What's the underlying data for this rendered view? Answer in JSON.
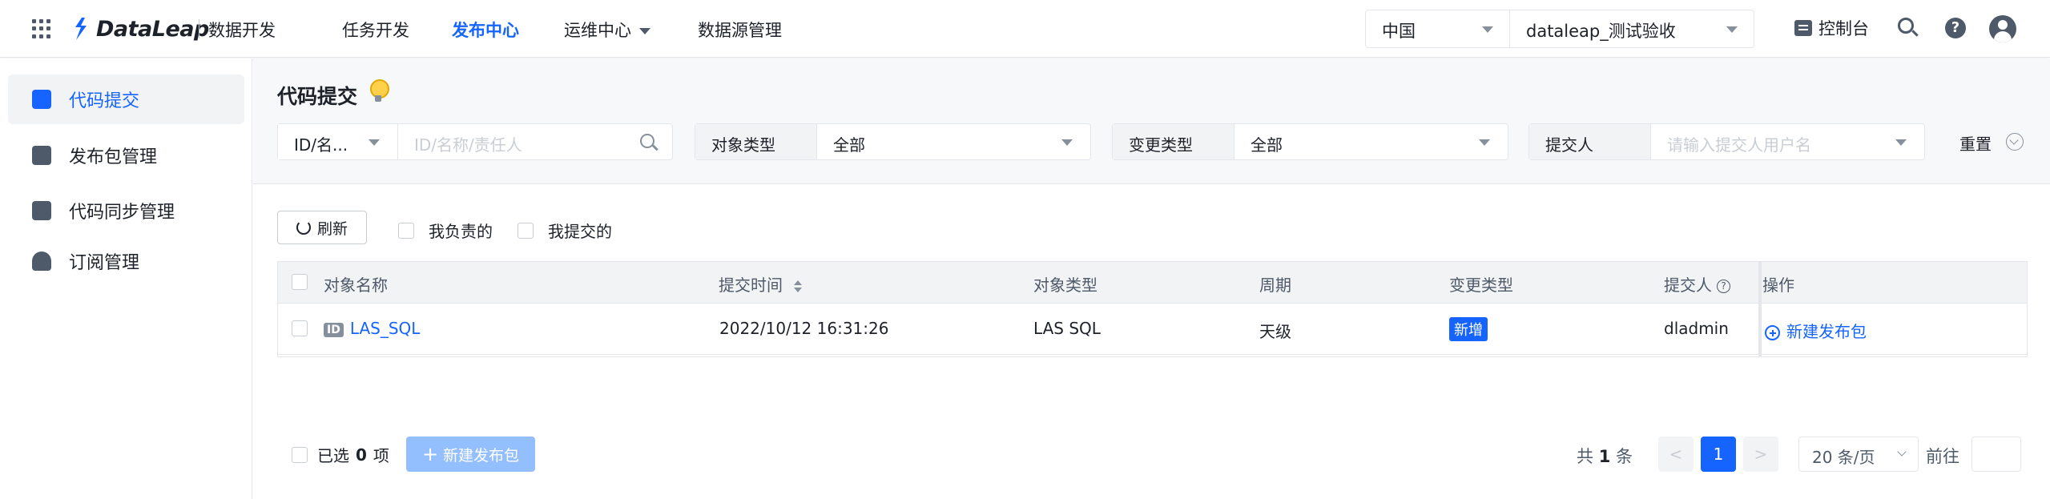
{
  "topbar": {
    "brand": "DataLeap",
    "product": "数据开发",
    "nav": [
      {
        "label": "任务开发",
        "active": false,
        "has_dropdown": false
      },
      {
        "label": "发布中心",
        "active": true,
        "has_dropdown": false
      },
      {
        "label": "运维中心",
        "active": false,
        "has_dropdown": true
      },
      {
        "label": "数据源管理",
        "active": false,
        "has_dropdown": false
      }
    ],
    "region": "中国",
    "project": "dataleap_测试验收",
    "console_label": "控制台",
    "icons": [
      "apps-grid-icon",
      "console-icon",
      "search-icon",
      "help-icon",
      "user-avatar-icon"
    ]
  },
  "sidebar": {
    "items": [
      {
        "label": "代码提交",
        "icon": "terminal-icon",
        "active": true
      },
      {
        "label": "发布包管理",
        "icon": "package-icon",
        "active": false
      },
      {
        "label": "代码同步管理",
        "icon": "code-sync-icon",
        "active": false
      },
      {
        "label": "订阅管理",
        "icon": "bell-icon",
        "active": false
      }
    ]
  },
  "page": {
    "title": "代码提交",
    "title_icon": "lightbulb-icon"
  },
  "filters": {
    "id_type": "ID/名...",
    "search_placeholder": "ID/名称/责任人",
    "object_type_label": "对象类型",
    "object_type_value": "全部",
    "change_type_label": "变更类型",
    "change_type_value": "全部",
    "submitter_label": "提交人",
    "submitter_placeholder": "请输入提交人用户名",
    "reset_label": "重置"
  },
  "toolbar": {
    "refresh_label": "刷新",
    "mine_label": "我负责的",
    "submitted_label": "我提交的"
  },
  "table": {
    "columns": [
      "对象名称",
      "提交时间",
      "对象类型",
      "周期",
      "变更类型",
      "提交人",
      "操作"
    ],
    "rows": [
      {
        "id_badge": "ID",
        "name": "LAS_SQL",
        "time": "2022/10/12  16:31:26",
        "type": "LAS SQL",
        "period": "天级",
        "change": "新增",
        "submitter": "dladmin",
        "action": "新建发布包"
      }
    ]
  },
  "footer": {
    "selected_prefix": "已选",
    "selected_count": "0",
    "selected_suffix": "项",
    "new_package_label": "新建发布包",
    "total_prefix": "共",
    "total_count": "1",
    "total_suffix": "条",
    "current_page": "1",
    "prev": "<",
    "next": ">",
    "page_size": "20 条/页",
    "goto_label": "前往"
  },
  "colors": {
    "accent": "#1664ff",
    "accent_disabled": "#94bfff",
    "header_bg": "#f7f8fa",
    "table_header_bg": "#f2f3f5"
  }
}
